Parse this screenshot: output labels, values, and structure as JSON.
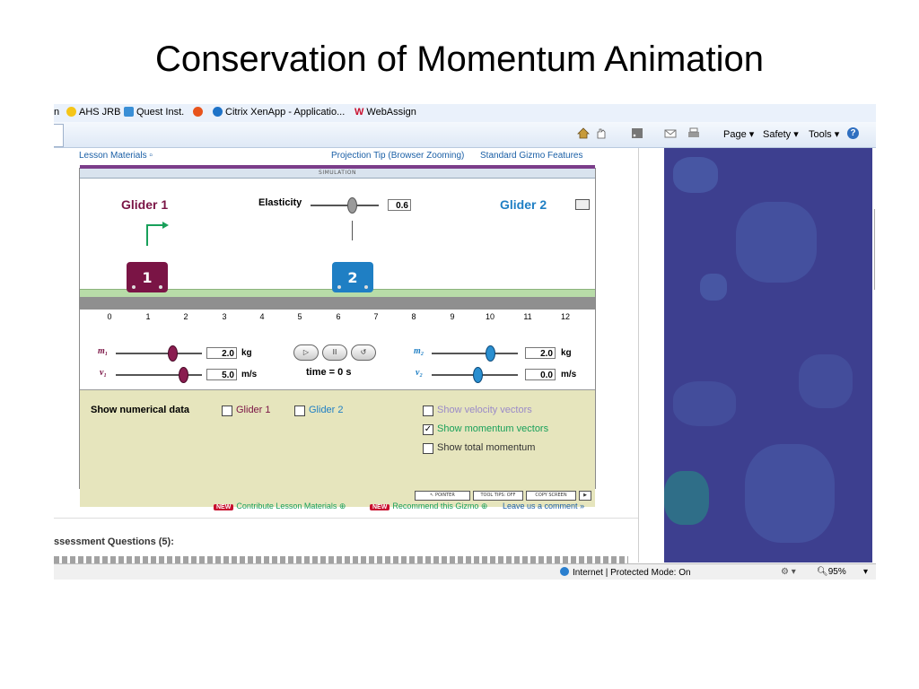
{
  "slide": {
    "title": "Conservation of Momentum Animation"
  },
  "favorites": [
    {
      "label": "n",
      "icon": "none"
    },
    {
      "label": "AHS JRB",
      "icon": "smiley-icon"
    },
    {
      "label": "Quest Inst.",
      "icon": "ie-page-icon"
    },
    {
      "label": "",
      "icon": "burst-icon"
    },
    {
      "label": "Citrix XenApp - Applicatio...",
      "icon": "citrix-icon"
    },
    {
      "label": "WebAssign",
      "icon": "webassign-icon"
    }
  ],
  "commandbar": {
    "page": "Page ▾",
    "safety": "Safety ▾",
    "tools": "Tools ▾",
    "help": "?"
  },
  "links": {
    "lesson_materials": "Lesson Materials",
    "projection_tip": "Projection Tip (Browser Zooming)",
    "standard_features": "Standard Gizmo Features"
  },
  "gizmo": {
    "sim_header": "SIMULATION",
    "glider1": "Glider 1",
    "glider2": "Glider 2",
    "glider1_num": "1",
    "glider2_num": "2",
    "elasticity_label": "Elasticity",
    "elasticity": "0.6",
    "ruler": [
      "0",
      "1",
      "2",
      "3",
      "4",
      "5",
      "6",
      "7",
      "8",
      "9",
      "10",
      "11",
      "12"
    ],
    "m1_label": "m₁",
    "v1_label": "v₁",
    "m2_label": "m₂",
    "v2_label": "v₂",
    "m1": "2.0",
    "v1": "5.0",
    "m2": "2.0",
    "v2": "0.0",
    "unit_kg": "kg",
    "unit_ms": "m/s",
    "time": "time = 0 s",
    "show_numerical": "Show numerical data",
    "cb_glider1": "Glider 1",
    "cb_glider2": "Glider 2",
    "cb_velocity": "Show velocity vectors",
    "cb_momentum": "Show momentum vectors",
    "cb_total": "Show total momentum",
    "btn_pointer": "↖ POINTER",
    "btn_tooltips": "TOOL TIPS: OFF",
    "btn_copy": "COPY SCREEN",
    "colors": {
      "glider1": "#7a1445",
      "glider2": "#1f7fc4",
      "accent_green": "#18a05a"
    }
  },
  "footer_links": {
    "new": "NEW",
    "contribute": "Contribute Lesson Materials",
    "recommend": "Recommend this Gizmo",
    "comment": "Leave us a comment"
  },
  "assessment": {
    "title": "ssessment Questions (5):"
  },
  "status": {
    "zone": "Internet | Protected Mode: On",
    "zoom": "95%"
  }
}
